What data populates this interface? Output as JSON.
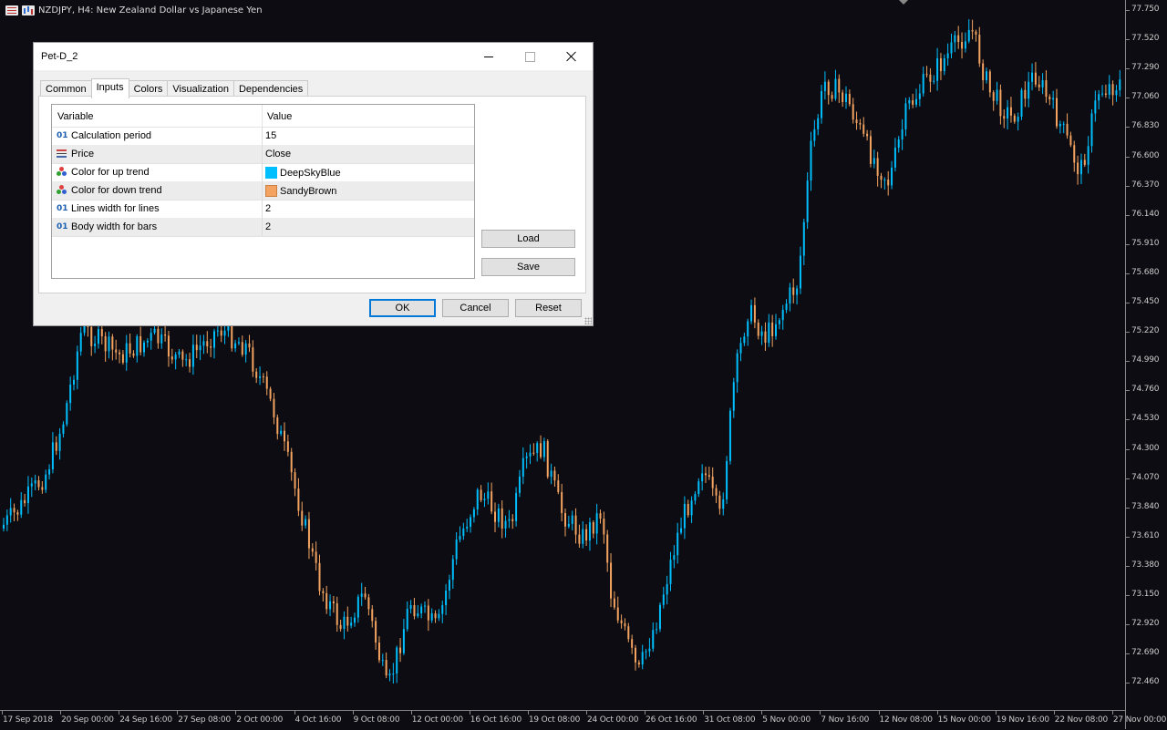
{
  "chart": {
    "symbol_caption": "NZDJPY, H4:  New Zealand Dollar vs Japanese Yen",
    "colors": {
      "background": "#0c0c12",
      "up": "#00bfff",
      "down": "#f4a460"
    },
    "price_labels": [
      "77.750",
      "77.520",
      "77.290",
      "77.060",
      "76.830",
      "76.600",
      "76.370",
      "76.140",
      "75.910",
      "75.680",
      "75.450",
      "75.220",
      "74.990",
      "74.760",
      "74.530",
      "74.300",
      "74.070",
      "73.840",
      "73.610",
      "73.380",
      "73.150",
      "72.920",
      "72.690",
      "72.460"
    ],
    "time_labels": [
      "17 Sep 2018",
      "20 Sep 00:00",
      "24 Sep 16:00",
      "27 Sep 08:00",
      "2 Oct 00:00",
      "4 Oct 16:00",
      "9 Oct 08:00",
      "12 Oct 00:00",
      "16 Oct 16:00",
      "19 Oct 08:00",
      "24 Oct 00:00",
      "26 Oct 16:00",
      "31 Oct 08:00",
      "5 Nov 00:00",
      "7 Nov 16:00",
      "12 Nov 08:00",
      "15 Nov 00:00",
      "19 Nov 16:00",
      "22 Nov 08:00",
      "27 Nov 00:00"
    ]
  },
  "dialog": {
    "title": "Pet-D_2",
    "tabs": [
      "Common",
      "Inputs",
      "Colors",
      "Visualization",
      "Dependencies"
    ],
    "active_tab": "Inputs",
    "grid": {
      "header": {
        "variable": "Variable",
        "value": "Value"
      },
      "rows": [
        {
          "icon": "int-icon",
          "icon_text": "01",
          "name": "Calculation period",
          "value": "15"
        },
        {
          "icon": "price-icon",
          "name": "Price",
          "value": "Close"
        },
        {
          "icon": "color-icon",
          "name": "Color for up trend",
          "value": "DeepSkyBlue",
          "swatch": "#00bfff"
        },
        {
          "icon": "color-icon",
          "name": "Color for down trend",
          "value": "SandyBrown",
          "swatch": "#f4a460"
        },
        {
          "icon": "int-icon",
          "icon_text": "01",
          "name": "Lines width for lines",
          "value": "2"
        },
        {
          "icon": "int-icon",
          "icon_text": "01",
          "name": "Body width for bars",
          "value": "2"
        }
      ]
    },
    "buttons": {
      "load": "Load",
      "save": "Save",
      "ok": "OK",
      "cancel": "Cancel",
      "reset": "Reset"
    }
  }
}
